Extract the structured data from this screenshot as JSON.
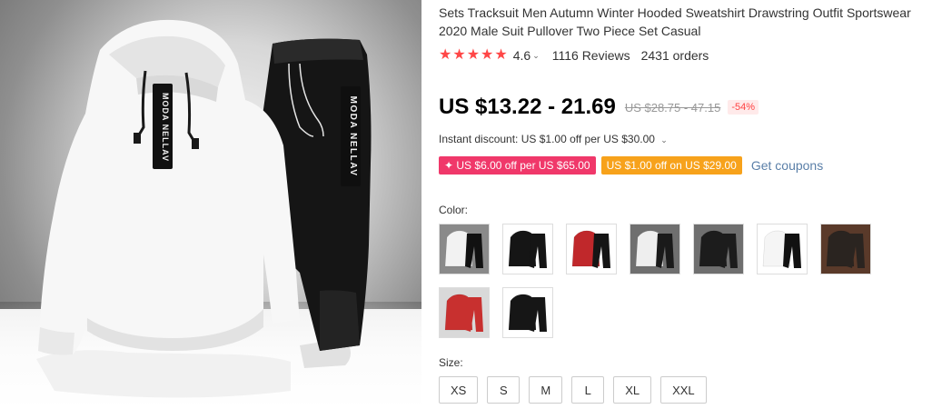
{
  "product": {
    "title": "Sets Tracksuit Men Autumn Winter Hooded Sweatshirt Drawstring Outfit Sportswear 2020 Male Suit Pullover Two Piece Set Casual",
    "image_print": "MODA NELLAV",
    "rating": {
      "stars": 5,
      "value": "4.6",
      "reviews": "1116 Reviews",
      "orders": "2431 orders"
    },
    "price": {
      "current": "US $13.22 - 21.69",
      "original": "US $28.75 - 47.15",
      "discount": "-54%"
    },
    "instant_discount": "Instant discount: US $1.00 off per US $30.00",
    "coupons": [
      {
        "label": "✦ US $6.00 off per US $65.00",
        "color": "#f0386a"
      },
      {
        "label": "US $1.00 off on US $29.00",
        "color": "#f7a21b"
      }
    ],
    "get_coupons": "Get coupons",
    "color_label": "Color:",
    "colors": [
      {
        "name": "white-black",
        "top": "#f2f2f2",
        "bottom": "#111111",
        "bg": "#8a8a8a"
      },
      {
        "name": "black",
        "top": "#151515",
        "bottom": "#151515",
        "bg": "#ffffff"
      },
      {
        "name": "red-black",
        "top": "#c0282b",
        "bottom": "#151515",
        "bg": "#ffffff"
      },
      {
        "name": "white-black-block",
        "top": "#eeeeee",
        "bottom": "#1a1a1a",
        "bg": "#6f6f6f"
      },
      {
        "name": "black-white-block",
        "top": "#1c1c1c",
        "bottom": "#1c1c1c",
        "bg": "#6f6f6f"
      },
      {
        "name": "white",
        "top": "#f5f5f5",
        "bottom": "#111111",
        "bg": "#ffffff"
      },
      {
        "name": "dark-brown",
        "top": "#2a2420",
        "bottom": "#2a2420",
        "bg": "#5a3a2a"
      },
      {
        "name": "red-grey",
        "top": "#c8302f",
        "bottom": "#c8302f",
        "bg": "#d9d9d9"
      },
      {
        "name": "black-white-stripe",
        "top": "#161616",
        "bottom": "#161616",
        "bg": "#ffffff"
      }
    ],
    "size_label": "Size:",
    "sizes": [
      "XS",
      "S",
      "M",
      "L",
      "XL",
      "XXL"
    ]
  }
}
